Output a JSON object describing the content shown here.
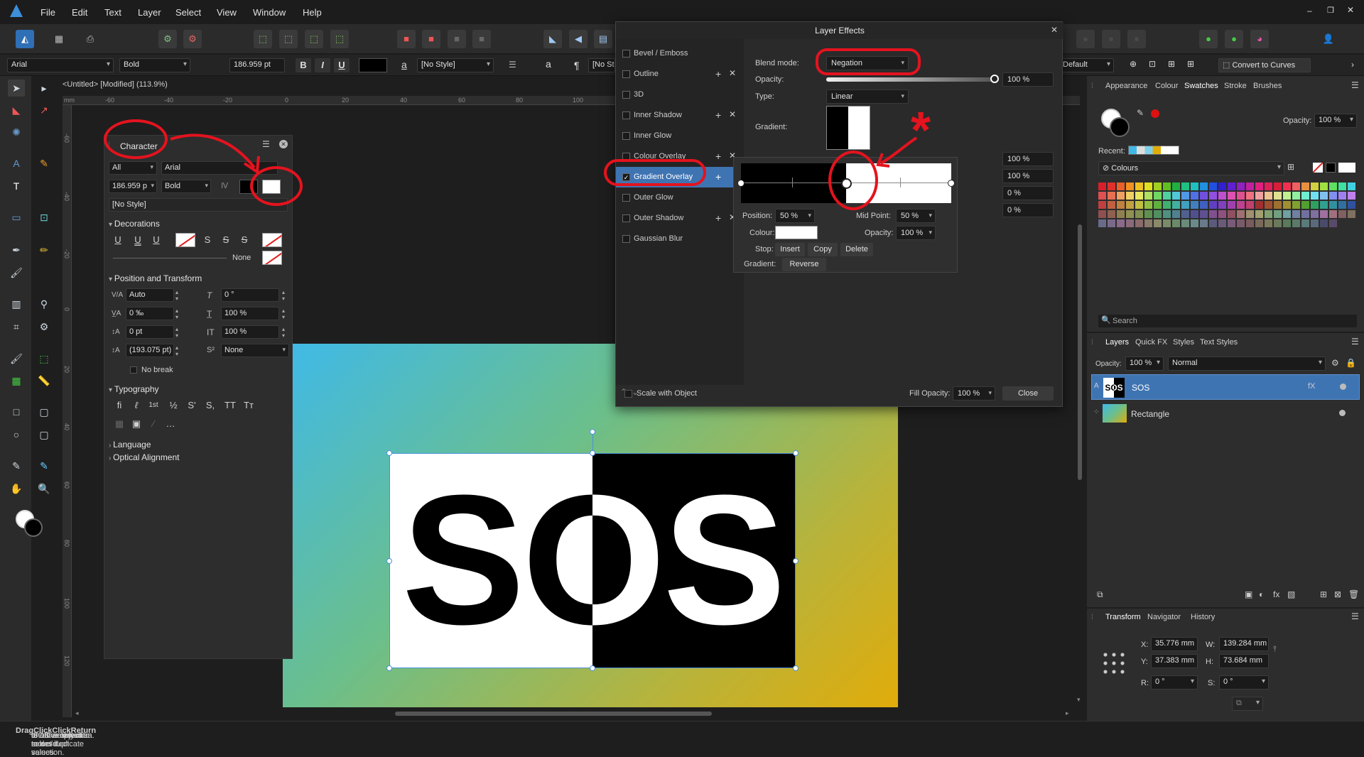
{
  "menu": [
    "File",
    "Edit",
    "Text",
    "Layer",
    "Select",
    "View",
    "Window",
    "Help"
  ],
  "context": {
    "font": "Arial",
    "weight": "Bold",
    "size": "186.959 pt",
    "bold": "B",
    "italic": "I",
    "underline": "U",
    "style": "[No Style]",
    "a_glyph": "a",
    "para": "¶",
    "style2": "[No St",
    "default": "Default",
    "convert": "Convert to Curves"
  },
  "document": {
    "tab": "<Untitled> [Modified] (113.9%)",
    "unit": "mm",
    "ruler_top": [
      "-60",
      "-40",
      "-20",
      "0",
      "20",
      "40",
      "60",
      "80",
      "100"
    ],
    "ruler_left": [
      "-60",
      "-40",
      "-20",
      "0",
      "20",
      "40",
      "60",
      "80",
      "100",
      "120"
    ]
  },
  "canvas": {
    "sos_text": "SOS"
  },
  "character": {
    "title": "Character",
    "scope": "All",
    "font": "Arial",
    "size": "186.959 p",
    "weight": "Bold",
    "style": "[No Style]",
    "decorations": {
      "title": "Decorations",
      "u1": "U",
      "u2": "U",
      "u3": "U",
      "s1": "S",
      "s2": "S",
      "s3": "S",
      "none": "None"
    },
    "position": {
      "title": "Position and Transform",
      "kern": "Auto",
      "shear": "0 °",
      "track": "0 ‰",
      "scale_v": "100 %",
      "baseline": "0 pt",
      "scale_h": "100 %",
      "leading": "(193.075 pt)",
      "case": "None",
      "nobreak": "No break"
    },
    "typography": {
      "title": "Typography",
      "g1": "fi",
      "g2": "ℓ",
      "g3": "1st",
      "g4": "½",
      "g5": "S'",
      "g6": "S,",
      "g7": "TT",
      "g8": "Tт",
      "g9": "…"
    },
    "language": "Language",
    "optical": "Optical Alignment"
  },
  "effects": {
    "title": "Layer Effects",
    "list": [
      {
        "label": "Bevel / Emboss",
        "checked": false
      },
      {
        "label": "Outline",
        "checked": false
      },
      {
        "label": "3D",
        "checked": false
      },
      {
        "label": "Inner Shadow",
        "checked": false
      },
      {
        "label": "Inner Glow",
        "checked": false
      },
      {
        "label": "Colour Overlay",
        "checked": false
      },
      {
        "label": "Gradient Overlay",
        "checked": true
      },
      {
        "label": "Outer Glow",
        "checked": false
      },
      {
        "label": "Outer Shadow",
        "checked": false
      },
      {
        "label": "Gaussian Blur",
        "checked": false
      }
    ],
    "blend_label": "Blend mode:",
    "blend": "Negation",
    "opacity_label": "Opacity:",
    "opacity": "100 %",
    "type_label": "Type:",
    "type": "Linear",
    "gradient_label": "Gradient:",
    "side_vals": [
      "100 %",
      "100 %",
      "0 %",
      "0 %"
    ],
    "gradient_popup": {
      "position_label": "Position:",
      "position": "50 %",
      "midpoint_label": "Mid Point:",
      "midpoint": "50 %",
      "colour_label": "Colour:",
      "opacity_label": "Opacity:",
      "opacity": "100 %",
      "stop_label": "Stop:",
      "insert": "Insert",
      "copy": "Copy",
      "delete": "Delete",
      "gradient_label": "Gradient:",
      "reverse": "Reverse"
    },
    "scale_with_object": "Scale with Object",
    "fill_opacity_label": "Fill Opacity:",
    "fill_opacity": "100 %",
    "close": "Close",
    "annotation_asterisk": "*"
  },
  "right": {
    "tabs": [
      "Appearance",
      "Colour",
      "Swatches",
      "Stroke",
      "Brushes"
    ],
    "active_tab": "Swatches",
    "opacity_label": "Opacity:",
    "opacity": "100 %",
    "recent_label": "Recent:",
    "palette": "Colours",
    "search": "Search",
    "layer_tabs": [
      "Layers",
      "Quick FX",
      "Styles",
      "Text Styles"
    ],
    "layer_opacity_label": "Opacity:",
    "layer_opacity": "100 %",
    "layer_blend": "Normal",
    "layers": [
      {
        "name": "SOS",
        "thumb": "SOS",
        "fx": "fX"
      },
      {
        "name": "Rectangle"
      }
    ],
    "transform_tabs": [
      "Transform",
      "Navigator",
      "History"
    ],
    "transform": {
      "x_label": "X:",
      "x": "35.776 mm",
      "y_label": "Y:",
      "y": "37.383 mm",
      "w_label": "W:",
      "w": "139.284 mm",
      "h_label": "H:",
      "h": "73.684 mm",
      "r_label": "R:",
      "r": "0 °",
      "s_label": "S:",
      "s": "0 °"
    }
  },
  "status": {
    "t1": "'SOS' selected. ",
    "b1": "Drag",
    "t2": " to move selection. ",
    "b2": "Click",
    "t3": " another object to select it. ",
    "b3": "Click",
    "t4": " on an empty area to deselect selection. ",
    "b4": "Return",
    "t5": " to enter move/duplicate values."
  },
  "colors": {
    "accent": "#3f74b3",
    "annotation": "#e4131e",
    "palette_rows": [
      [
        "#d8202a",
        "#e0302a",
        "#e8602a",
        "#f09020",
        "#f0c020",
        "#e0e020",
        "#a0d020",
        "#60c020",
        "#20b040",
        "#20c080",
        "#20c0c0",
        "#2090e0",
        "#2050e0",
        "#3020d0",
        "#6020d0",
        "#9020c0",
        "#c020a0",
        "#e02080",
        "#e0205a",
        "#d81f3a",
        "#f03050",
        "#f06060",
        "#e89040",
        "#d0d040",
        "#a0e040",
        "#60e060",
        "#40e0a0",
        "#40d0e0"
      ],
      [
        "#e05050",
        "#e87050",
        "#f0a060",
        "#f0d060",
        "#e8e860",
        "#b0e060",
        "#70d860",
        "#50d0a0",
        "#50c8d8",
        "#5098e8",
        "#5070e8",
        "#7050e0",
        "#9050e0",
        "#c050d0",
        "#e050b0",
        "#e05090",
        "#f07080",
        "#f0a0a0",
        "#f0c090",
        "#e0e090",
        "#c0f090",
        "#90f0a0",
        "#70f0d0",
        "#70e0f0",
        "#80c0f0",
        "#8090f0",
        "#a080f0",
        "#c080f0"
      ],
      [
        "#c04040",
        "#c06040",
        "#c08040",
        "#c0a040",
        "#c0c040",
        "#90c040",
        "#60b040",
        "#40b070",
        "#40b0a0",
        "#40a0c0",
        "#4080c0",
        "#4060c0",
        "#6040c0",
        "#8040c0",
        "#a040b0",
        "#c04090",
        "#c04070",
        "#a03030",
        "#a05030",
        "#a07030",
        "#a09030",
        "#80a030",
        "#50a030",
        "#30a060",
        "#30a090",
        "#3090a0",
        "#3070a0",
        "#3050a0"
      ],
      [
        "#905050",
        "#906050",
        "#908050",
        "#909050",
        "#809050",
        "#609050",
        "#509060",
        "#509080",
        "#508090",
        "#506090",
        "#505090",
        "#605090",
        "#805090",
        "#905080",
        "#905060",
        "#a07070",
        "#a09070",
        "#a0a070",
        "#80a070",
        "#70a080",
        "#70a0a0",
        "#7080a0",
        "#7070a0",
        "#8070a0",
        "#a070a0",
        "#a07080",
        "#806060",
        "#807060"
      ],
      [
        "#6a6a8a",
        "#7a6a8a",
        "#8a6a8a",
        "#8a6a7a",
        "#8a6a6a",
        "#8a7a6a",
        "#8a8a6a",
        "#7a8a6a",
        "#6a8a6a",
        "#6a8a7a",
        "#6a8a8a",
        "#6a7a8a",
        "#5a5a7a",
        "#6a5a7a",
        "#7a5a7a",
        "#7a5a6a",
        "#7a5a5a",
        "#7a6a5a",
        "#7a7a5a",
        "#6a7a5a",
        "#5a7a5a",
        "#5a7a6a",
        "#5a7a7a",
        "#5a6a7a",
        "#4a4a6a",
        "#5a4a6a"
      ]
    ]
  }
}
